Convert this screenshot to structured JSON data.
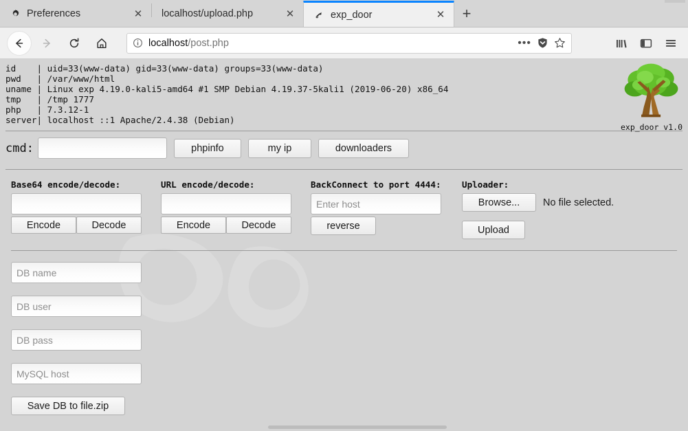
{
  "browser": {
    "tabs": [
      {
        "title": "Preferences",
        "favicon": "gear-icon",
        "active": false,
        "close_label": "✕"
      },
      {
        "title": "localhost/upload.php",
        "favicon": "blank-page-icon",
        "active": false,
        "close_label": "✕"
      },
      {
        "title": "exp_door",
        "favicon": "exp-door-icon",
        "active": true,
        "close_label": "✕"
      }
    ],
    "new_tab_label": "+",
    "nav": {
      "back_icon": "back-arrow-icon",
      "forward_icon": "forward-arrow-icon",
      "reload_icon": "reload-icon",
      "home_icon": "home-icon"
    },
    "url": {
      "host": "localhost",
      "path": "/post.php",
      "full": "localhost/post.php",
      "info_icon": "info-circle-icon",
      "page_actions_label": "•••",
      "shield_icon": "shield-icon",
      "bookmark_icon": "star-icon"
    },
    "right_icons": [
      {
        "name": "library-icon"
      },
      {
        "name": "sidebar-icon"
      },
      {
        "name": "menu-hamburger-icon"
      }
    ]
  },
  "shell": {
    "sysinfo": "id    | uid=33(www-data) gid=33(www-data) groups=33(www-data)\npwd   | /var/www/html\nuname | Linux exp 4.19.0-kali5-amd64 #1 SMP Debian 4.19.37-5kali1 (2019-06-20) x86_64\ntmp   | /tmp 1777\nphp   | 7.3.12-1\nserver| localhost ::1 Apache/2.4.38 (Debian)",
    "logo_name": "tree-logo",
    "version": "exp_door v1.0",
    "cmd": {
      "label": "cmd:",
      "value": "",
      "placeholder": "",
      "buttons": [
        {
          "label": "phpinfo",
          "name": "phpinfo-button"
        },
        {
          "label": "my ip",
          "name": "my-ip-button"
        },
        {
          "label": "downloaders",
          "name": "downloaders-button"
        }
      ]
    },
    "tools": {
      "base64": {
        "title": "Base64 encode/decode:",
        "value": "",
        "placeholder": "",
        "encode_label": "Encode",
        "decode_label": "Decode"
      },
      "url": {
        "title": "URL encode/decode:",
        "value": "",
        "placeholder": "",
        "encode_label": "Encode",
        "decode_label": "Decode"
      },
      "backconnect": {
        "title": "BackConnect to port 4444:",
        "value": "",
        "placeholder": "Enter host",
        "button_label": "reverse"
      },
      "uploader": {
        "title": "Uploader:",
        "browse_label": "Browse...",
        "file_status": "No file selected.",
        "upload_label": "Upload"
      }
    },
    "db": {
      "name": {
        "value": "",
        "placeholder": "DB name"
      },
      "user": {
        "value": "",
        "placeholder": "DB user"
      },
      "pass": {
        "value": "",
        "placeholder": "DB pass"
      },
      "host": {
        "value": "",
        "placeholder": "MySQL host"
      },
      "save_label": "Save DB to file.zip"
    }
  },
  "colors": {
    "page_bg": "#d4d4d4",
    "chrome_bg": "#f0f0f0",
    "tabstrip_bg": "#d6d6d6",
    "active_tab_accent": "#0a84ff",
    "rule": "#9a9a9a",
    "tree_leaf": "#5cb92a",
    "tree_trunk": "#8a5a1e"
  }
}
